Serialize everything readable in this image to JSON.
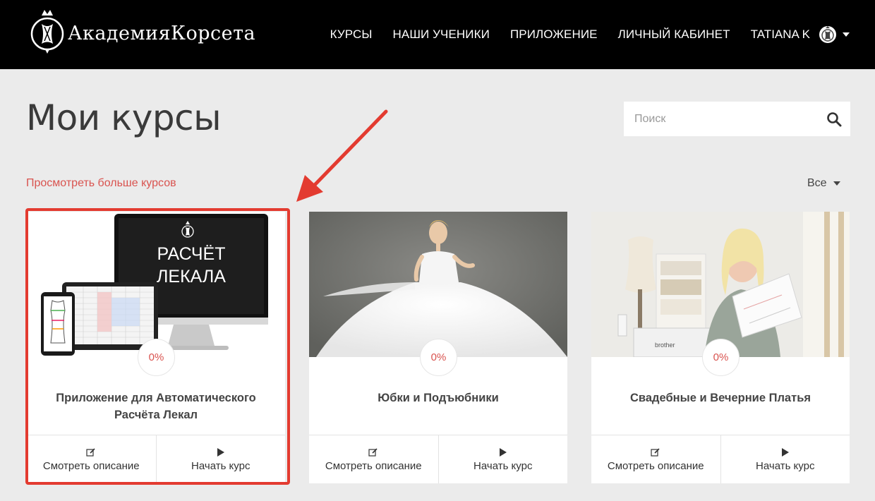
{
  "header": {
    "logo_text": "АкадемияКорсета",
    "nav": [
      {
        "label": "КУРСЫ"
      },
      {
        "label": "НАШИ УЧЕНИКИ"
      },
      {
        "label": "ПРИЛОЖЕНИЕ"
      },
      {
        "label": "ЛИЧНЫЙ КАБИНЕТ"
      }
    ],
    "user_name": "TATIANA K"
  },
  "main": {
    "title": "Мои курсы",
    "search_placeholder": "Поиск",
    "more_courses_link": "Просмотреть больше курсов",
    "filter_label": "Все"
  },
  "courses": [
    {
      "title": "Приложение для Автоматического Расчёта Лекал",
      "image_text_line1": "РАСЧЁТ",
      "image_text_line2": "ЛЕКАЛА",
      "progress": "0%",
      "describe_label": "Смотреть описание",
      "start_label": "Начать курс"
    },
    {
      "title": "Юбки и Подъюбники",
      "progress": "0%",
      "describe_label": "Смотреть описание",
      "start_label": "Начать курс"
    },
    {
      "title": "Свадебные и Вечерние Платья",
      "image_text": "brother",
      "progress": "0%",
      "describe_label": "Смотреть описание",
      "start_label": "Начать курс"
    }
  ],
  "colors": {
    "accent": "#d9534f",
    "annotation": "#e33b30",
    "header_bg": "#000000",
    "page_bg": "#ebebeb"
  }
}
